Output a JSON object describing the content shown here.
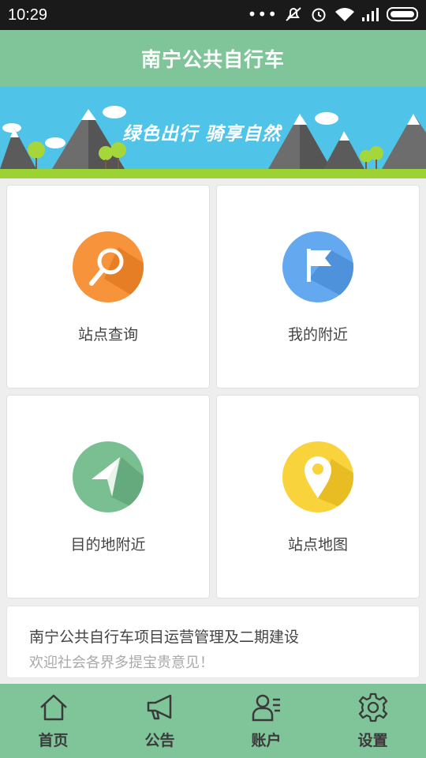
{
  "status": {
    "time": "10:29"
  },
  "header": {
    "title": "南宁公共自行车"
  },
  "banner": {
    "slogan": "绿色出行  骑享自然"
  },
  "grid": [
    {
      "label": "站点查询",
      "icon": "search-icon",
      "color": "#f7933a"
    },
    {
      "label": "我的附近",
      "icon": "flag-icon",
      "color": "#64a8f0"
    },
    {
      "label": "目的地附近",
      "icon": "navigation-arrow-icon",
      "color": "#79bf91"
    },
    {
      "label": "站点地图",
      "icon": "map-pin-icon",
      "color": "#f9d33c"
    }
  ],
  "notice": {
    "title": "南宁公共自行车项目运营管理及二期建设",
    "subtitle": "欢迎社会各界多提宝贵意见！"
  },
  "tabs": [
    {
      "label": "首页",
      "icon": "home-icon"
    },
    {
      "label": "公告",
      "icon": "megaphone-icon"
    },
    {
      "label": "账户",
      "icon": "account-icon"
    },
    {
      "label": "设置",
      "icon": "settings-gear-icon"
    }
  ]
}
